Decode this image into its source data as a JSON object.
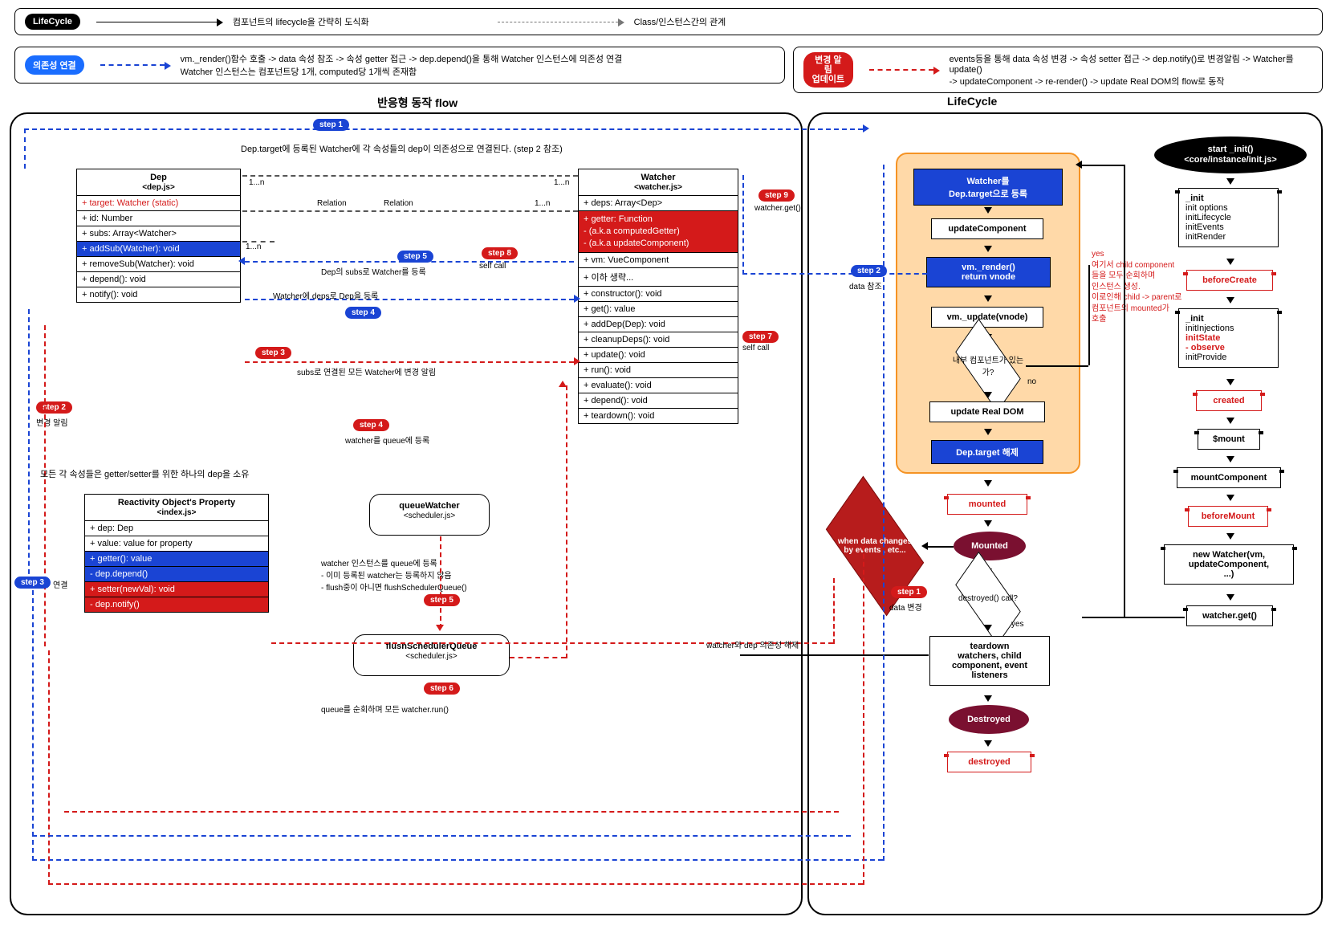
{
  "legend": {
    "lifecycle_pill": "LifeCycle",
    "lifecycle_desc": "컴포넌트의 lifecycle을 간략히 도식화",
    "class_desc": "Class/인스턴스간의 관계",
    "dep_pill": "의존성 연결",
    "dep_text": "vm._render()함수 호출 -> data 속성 참조 -> 속성 getter 접근 -> dep.depend()을 통해 Watcher 인스턴스에 의존성 연결\nWatcher 인스턴스는 컴포넌트당 1개, computed당 1개씩 존재함",
    "upd_pill": "변경 알림\n업데이트",
    "upd_text": "events등을 통해  data 속성 변경 -> 속성 setter 접근 -> dep.notify()로 변경알림 -> Watcher를 update()\n-> updateComponent -> re-render() -> update Real DOM의 flow로 동작"
  },
  "titles": {
    "flow": "반응형 동작 flow",
    "lifecycle": "LifeCycle"
  },
  "dep": {
    "name": "Dep",
    "file": "<dep.js>",
    "target": "+ target: Watcher (static)",
    "id": "+ id: Number",
    "subs": "+ subs: Array<Watcher>",
    "addSub": "+ addSub(Watcher): void",
    "removeSub": "+ removeSub(Watcher): void",
    "depend": "+ depend(): void",
    "notify": "+ notify(): void"
  },
  "watcher": {
    "name": "Watcher",
    "file": "<watcher.js>",
    "deps": "+ deps: Array<Dep>",
    "getter1": "+ getter: Function",
    "getter2": "- (a.k.a computedGetter)",
    "getter3": "- (a.k.a updateComponent)",
    "vm": "+ vm: VueComponent",
    "etc": "+ 이하 생략...",
    "ctor": "+ constructor(): void",
    "get": "+ get(): value",
    "addDep": "+ addDep(Dep): void",
    "cleanup": "+ cleanupDeps(): void",
    "update": "+ update(): void",
    "run": "+ run(): void",
    "evaluate": "+ evaluate(): void",
    "depend2": "+ depend(): void",
    "teardown": "+ teardown(): void"
  },
  "reactivity": {
    "name": "Reactivity Object's Property",
    "file": "<index.js>",
    "dep": "+ dep: Dep",
    "value": "+ value: value for property",
    "getter": "+ getter(): value",
    "depdepend": "- dep.depend()",
    "setter": "+ setter(newVal): void",
    "depnotify": "- dep.notify()"
  },
  "queue": {
    "name": "queueWatcher",
    "file": "<scheduler.js>",
    "n1": "watcher 인스턴스를 queue에 등록",
    "n2": "- 이미 등록된 watcher는 등록하지 않음",
    "n3": "- flush중이 아니면 flushSchedulerQueue()"
  },
  "flush": {
    "name": "flushSchedulerQueue",
    "file": "<scheduler.js>",
    "note": "queue를 순회하며 모든 watcher.run()"
  },
  "notes": {
    "step1_top": "Dep.target에 등록된 Watcher에 각 속성들의 dep이 의존성으로 연결된다. (step 2 참조)",
    "relation": "Relation",
    "oneN": "1...n",
    "s5": "Dep의 subs로 Watcher를 등록",
    "s4": "Watcher에 deps로 Dep을 등록",
    "rs3": "subs로 연결된 모든 Watcher에 변경 알림",
    "rs4": "watcher를 queue에 등록",
    "rs2": "변경 알림",
    "own": "모든 각 속성들은 getter/setter를 위한 하나의 dep을 소유",
    "s8": "self call",
    "s7_label": "self call",
    "s9": "watcher.get()",
    "step2_right": "data 참조",
    "step3_left": "연결",
    "step1_right": "data 변경",
    "cleanup": "watcher와 dep 의존성 해제",
    "yes_note": "yes\n여기서 child component\n들을 모두 순회하며\n인스턴스 생성.\n이로인해 child -> parent로\n컴포넌트의 mounted가\n호출"
  },
  "steps": {
    "s1": "step 1",
    "s2": "step 2",
    "s3": "step 3",
    "s4": "step 4",
    "s5": "step 5",
    "s6": "step 6",
    "s7": "step 7",
    "s8": "step 8",
    "s9": "step 9"
  },
  "lc_flow": {
    "reg": "Watcher를\nDep.target으로 등록",
    "uc": "updateComponent",
    "render": "vm._render()\nreturn vnode",
    "upd": "vm._update(vnode)",
    "q": "내부 컴포넌트가 있는가?",
    "no": "no",
    "real": "update Real DOM",
    "rel": "Dep.target 해제",
    "mounted_lbl": "mounted",
    "mounted_oval": "Mounted",
    "change": "when data changes\nby events , etc...",
    "destroyed_q": "destroyed() call?",
    "yes": "yes",
    "teardown": "teardown\nwatchers, child\ncomponent, event\nlisteners",
    "destroyed_oval": "Destroyed",
    "destroyed_lbl": "destroyed"
  },
  "lc_right": {
    "start": "start _init()\n<core/instance/init.js>",
    "init1": "_init",
    "init1a": "init options",
    "init1b": "initLifecycle",
    "init1c": "initEvents",
    "init1d": "initRender",
    "beforeCreate": "beforeCreate",
    "init2": "_init",
    "init2a": "initInjections",
    "init2b": "initState",
    "init2c": "- observe",
    "init2d": "initProvide",
    "created": "created",
    "mount": "$mount",
    "mc": "mountComponent",
    "beforeMount": "beforeMount",
    "newW": "new Watcher(vm,\nupdateComponent,\n...)",
    "wget": "watcher.get()"
  }
}
